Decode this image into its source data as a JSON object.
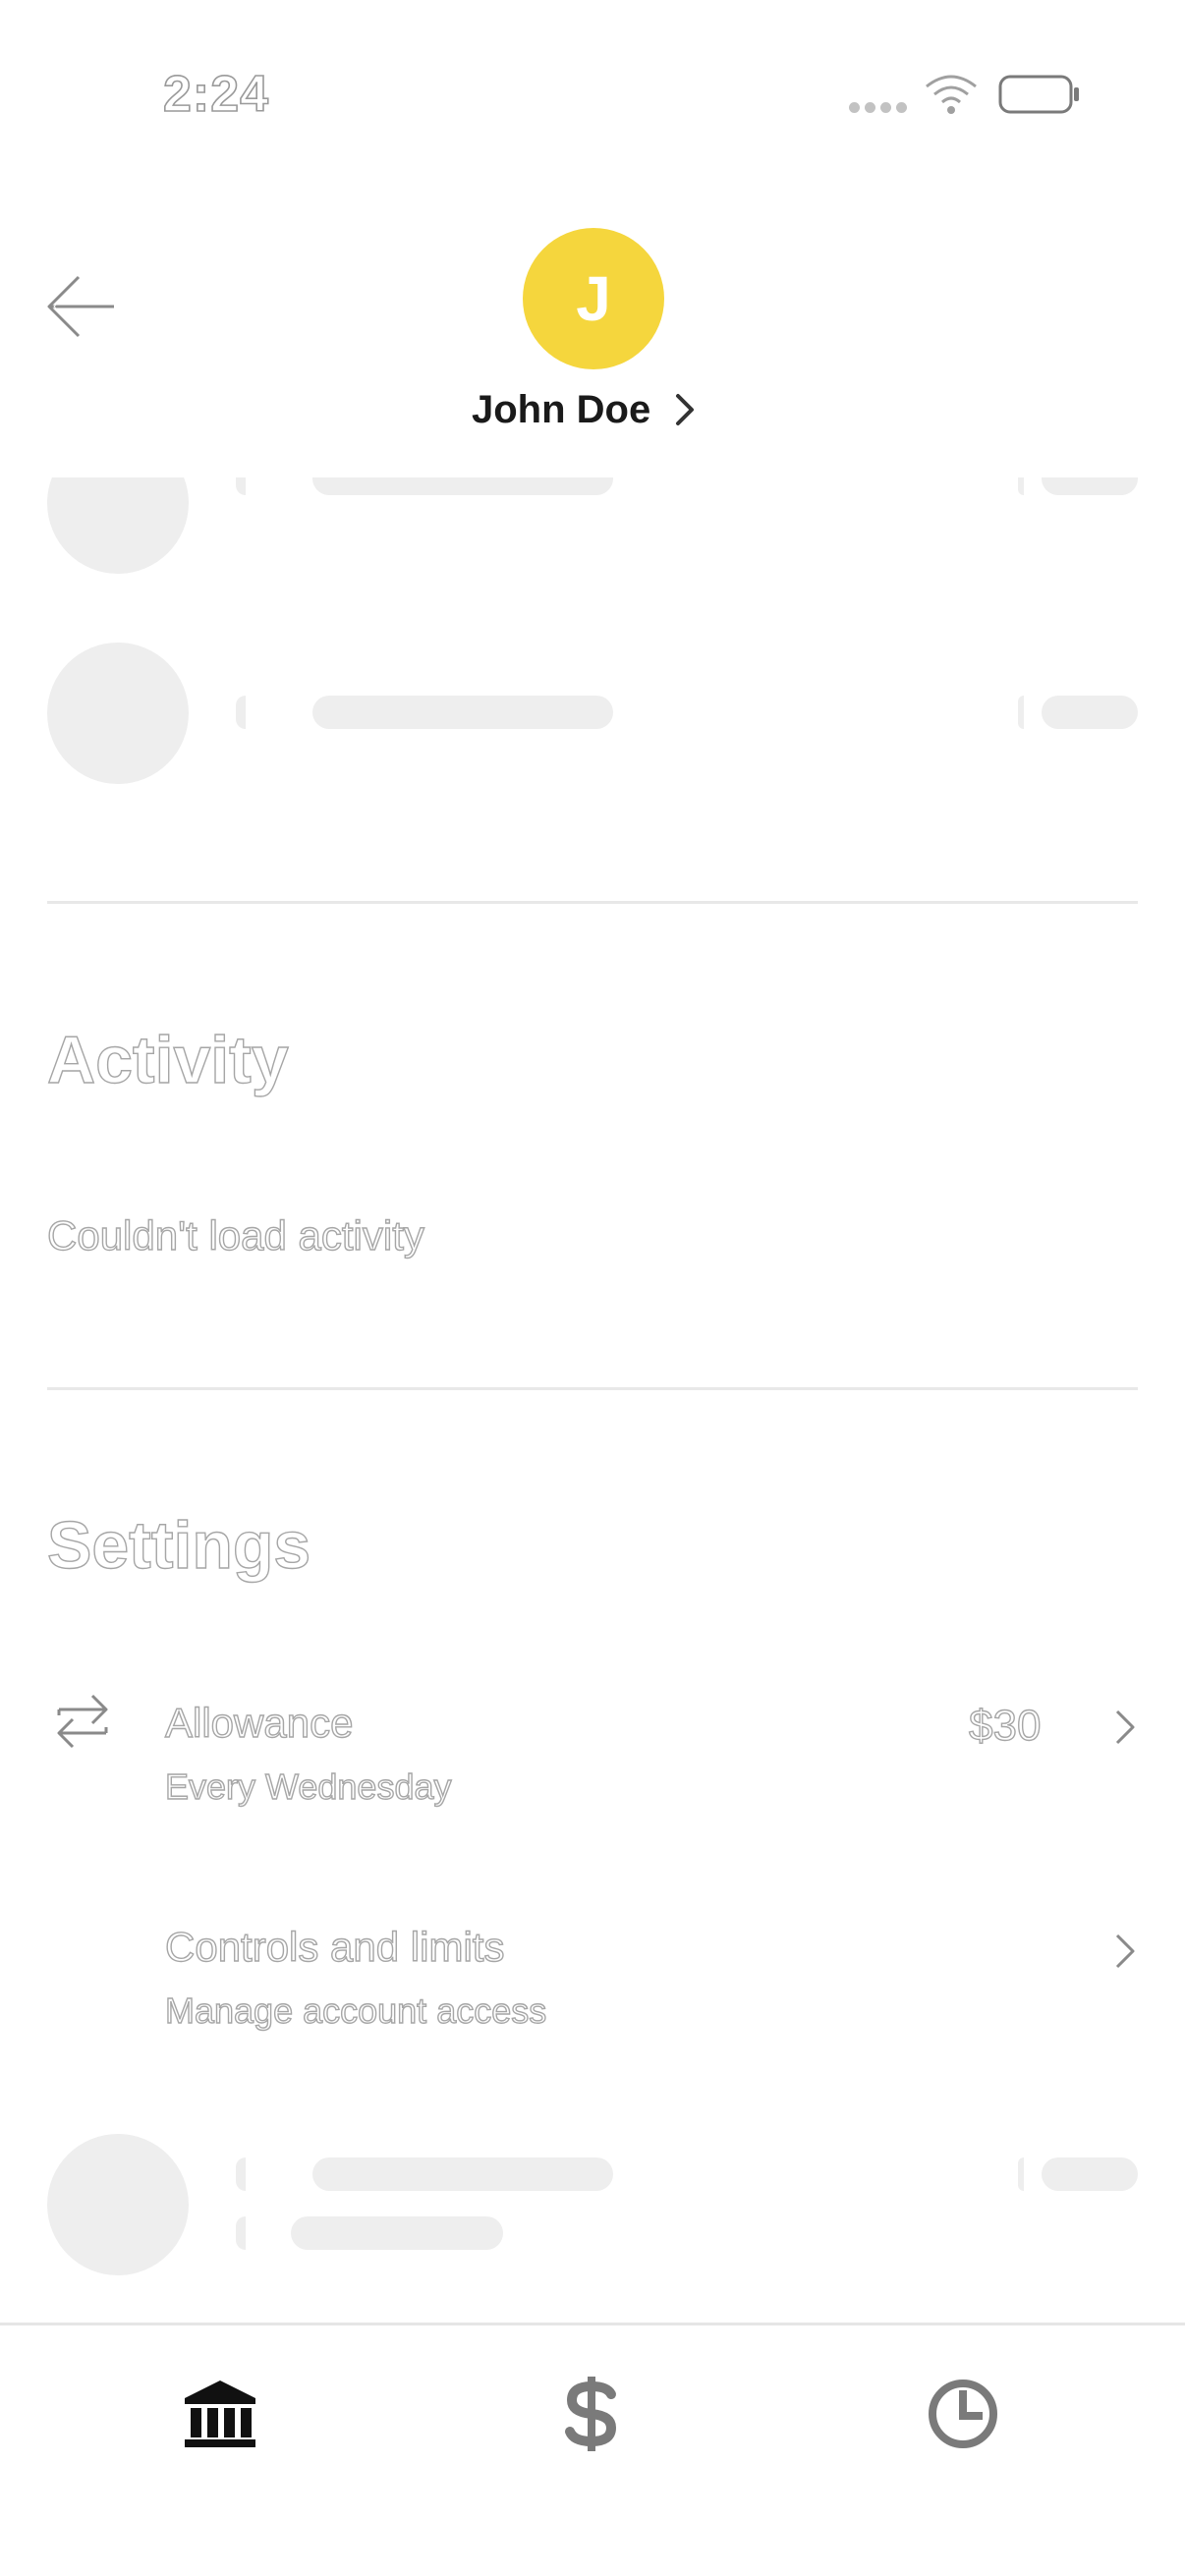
{
  "status_bar": {
    "time": "2:24"
  },
  "header": {
    "avatar_initial": "J",
    "name": "John Doe",
    "avatar_color": "#f5d63d"
  },
  "activity": {
    "title": "Activity",
    "message": "Couldn't load activity"
  },
  "settings": {
    "title": "Settings",
    "items": [
      {
        "title": "Allowance",
        "subtitle": "Every Wednesday",
        "value": "$30",
        "icon": "repeat-arrows-icon"
      },
      {
        "title": "Controls and limits",
        "subtitle": "Manage account access"
      }
    ]
  },
  "bottom_nav": {
    "items": [
      {
        "icon": "bank-icon",
        "active": true
      },
      {
        "icon": "dollar-icon",
        "active": false
      },
      {
        "icon": "clock-icon",
        "active": false
      }
    ]
  }
}
